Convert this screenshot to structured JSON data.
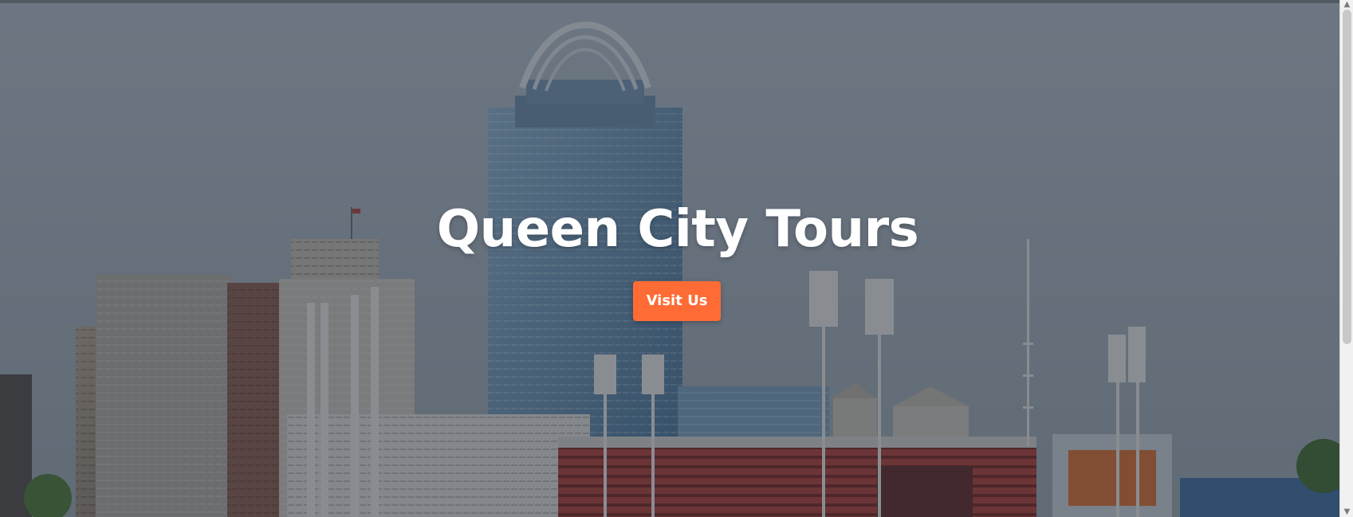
{
  "hero": {
    "title": "Queen City Tours",
    "button_label": "Visit Us"
  },
  "colors": {
    "accent": "#ff6b35",
    "overlay": "#28303a",
    "title": "#ffffff"
  },
  "icons": {
    "scroll_up": "chevron-up-icon",
    "scroll_down": "chevron-down-icon"
  }
}
